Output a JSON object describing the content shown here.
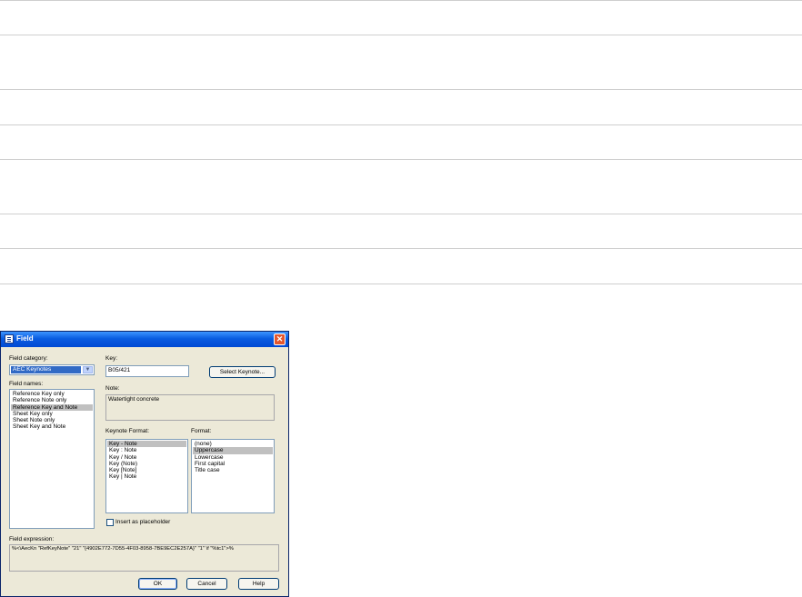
{
  "dialog": {
    "title": "Field",
    "close_glyph": "✕",
    "field_category_label": "Field category:",
    "field_category_value": "AEC Keynotes",
    "field_names_label": "Field names:",
    "field_names": [
      "Reference Key only",
      "Reference Note only",
      "Reference Key and Note",
      "Sheet Key only",
      "Sheet Note only",
      "Sheet Key and Note"
    ],
    "field_names_selected": 2,
    "key_label": "Key:",
    "key_value": "B05/421",
    "select_keynote_label": "Select Keynote...",
    "note_label": "Note:",
    "note_value": "Watertight concrete",
    "keynote_format_label": "Keynote Format:",
    "keynote_formats": [
      "Key - Note",
      "Key : Note",
      "Key / Note",
      "Key (Note)",
      "Key [Note]",
      "Key | Note"
    ],
    "keynote_format_selected": 0,
    "format_label": "Format:",
    "formats": [
      "(none)",
      "Uppercase",
      "Lowercase",
      "First capital",
      "Title case"
    ],
    "format_selected": 1,
    "insert_placeholder_label": "Insert as placeholder",
    "insert_placeholder_checked": false,
    "field_expression_label": "Field expression:",
    "field_expression_value": "%<\\AecKn \"RefKeyNote\" \"21\" \"{4902E772-7D55-4F03-8958-7BE9EC2E257A}\" \"1\" \\f \"%tc1\">%",
    "ok_label": "OK",
    "cancel_label": "Cancel",
    "help_label": "Help"
  },
  "colors": {
    "titlebar": "#0a5ce0",
    "dialog_bg": "#ece9d8",
    "selection": "#316ac5",
    "rule": "#cfcfcf"
  }
}
